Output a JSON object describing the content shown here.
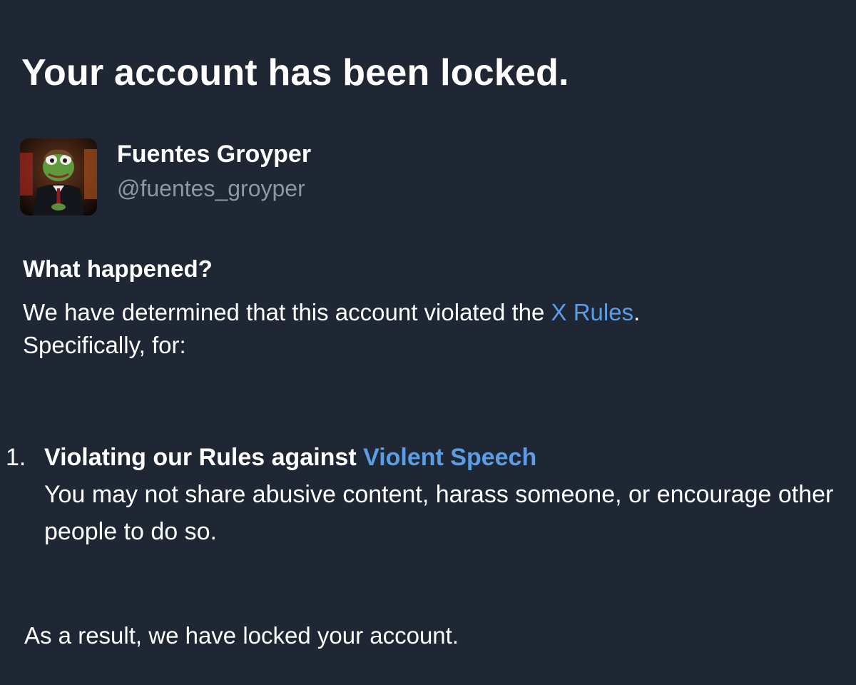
{
  "page_title": "Your account has been locked.",
  "account": {
    "display_name": "Fuentes Groyper",
    "handle": "@fuentes_groyper",
    "avatar_icon": "avatar-image"
  },
  "what_happened": {
    "heading": "What happened?",
    "text_before_link": "We have determined that this account violated the ",
    "rules_link": "X Rules",
    "text_after_link": ".",
    "specifically": "Specifically, for:"
  },
  "violations": [
    {
      "number": "1.",
      "title_prefix": "Violating our Rules against ",
      "title_link": "Violent Speech",
      "description": "You may not share abusive content, harass someone, or encourage other people to do so."
    }
  ],
  "result": "As a result, we have locked your account.",
  "colors": {
    "background": "#1e2733",
    "text": "#ffffff",
    "secondary_text": "#8b98a5",
    "link": "#5b9ee6"
  }
}
